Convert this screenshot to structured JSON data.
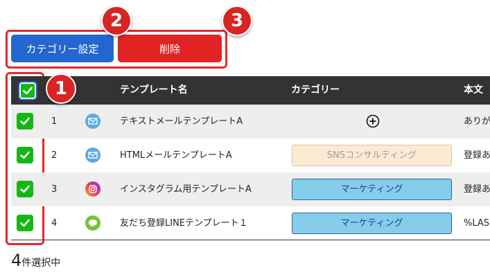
{
  "toolbar": {
    "category_button": "カテゴリー設定",
    "delete_button": "削除"
  },
  "callouts": [
    "1",
    "2",
    "3"
  ],
  "table": {
    "headers": {
      "select": "",
      "number": "",
      "type": "",
      "name": "テンプレート名",
      "category": "カテゴリー",
      "body": "本文"
    },
    "rows": [
      {
        "checked": true,
        "no": "1",
        "icon": "mail-icon",
        "name": "テキストメールテンプレートA",
        "category": "",
        "category_style": "add",
        "body": "ありが"
      },
      {
        "checked": true,
        "no": "2",
        "icon": "mail-icon",
        "name": "HTMLメールテンプレートA",
        "category": "SNSコンサルティング",
        "category_style": "sns",
        "body": "登録あ"
      },
      {
        "checked": true,
        "no": "3",
        "icon": "instagram-icon",
        "name": "インスタグラム用テンプレートA",
        "category": "マーケティング",
        "category_style": "marketing",
        "body": "登録あ"
      },
      {
        "checked": true,
        "no": "4",
        "icon": "line-icon",
        "name": "友だち登録LINEテンプレート１",
        "category": "マーケティング",
        "category_style": "marketing",
        "body": "%LAS"
      }
    ]
  },
  "selection": {
    "count": "4",
    "label": "件選択中"
  },
  "colors": {
    "primary": "#2466d0",
    "danger": "#e22323",
    "checkbox": "#14b814",
    "callout": "#d92424",
    "header_bg": "#333333"
  }
}
